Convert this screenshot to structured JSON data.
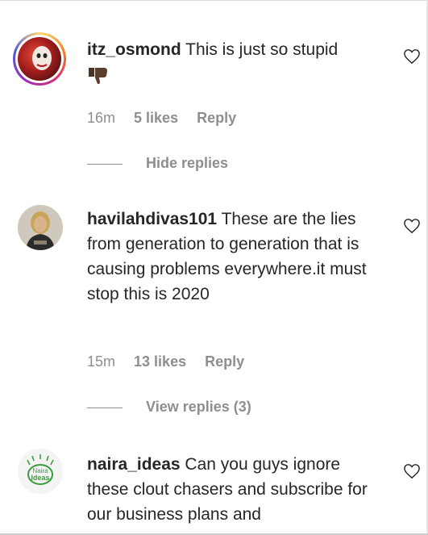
{
  "comments": [
    {
      "username": "itz_osmond",
      "text": "This is just so stupid",
      "emoji": "thumbs-down-emoji",
      "time": "16m",
      "likes": "5 likes",
      "reply": "Reply",
      "replies_toggle": "Hide replies"
    },
    {
      "username": "havilahdivas101",
      "text": "These are the lies from generation to generation that is causing problems everywhere.it must stop this is 2020",
      "time": "15m",
      "likes": "13 likes",
      "reply": "Reply",
      "replies_toggle": "View replies (3)"
    },
    {
      "username": "naira_ideas",
      "text": "Can you guys ignore these clout chasers and subscribe for our business plans and",
      "avatar_logo_text": "Naira Ideas"
    }
  ],
  "colors": {
    "text": "#262626",
    "secondary": "#8e8e8e",
    "story_ring": "#e1306c",
    "logo_green": "#3a9d3a"
  },
  "icons": {
    "like": "heart-outline-icon"
  }
}
